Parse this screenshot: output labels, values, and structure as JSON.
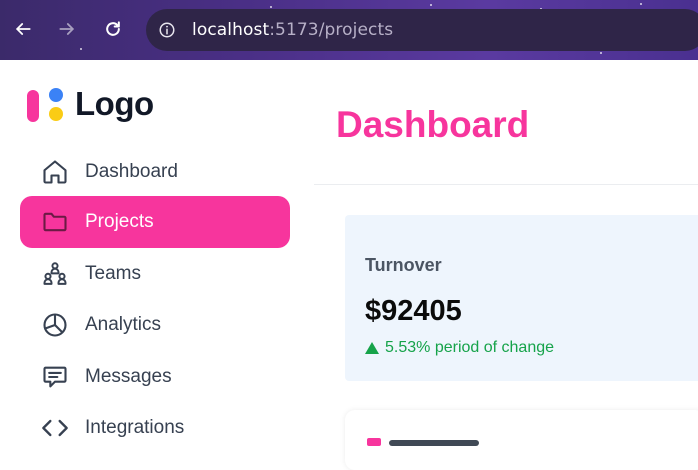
{
  "browser": {
    "url_host": "localhost",
    "url_rest": ":5173/projects"
  },
  "logo": {
    "text": "Logo"
  },
  "colors": {
    "accent": "#f7359d",
    "positive": "#16a34a",
    "card_bg": "#eef5fd"
  },
  "sidebar": {
    "items": [
      {
        "label": "Dashboard",
        "icon": "home-icon",
        "active": false
      },
      {
        "label": "Projects",
        "icon": "folder-icon",
        "active": true
      },
      {
        "label": "Teams",
        "icon": "teams-icon",
        "active": false
      },
      {
        "label": "Analytics",
        "icon": "pie-chart-icon",
        "active": false
      },
      {
        "label": "Messages",
        "icon": "message-icon",
        "active": false
      },
      {
        "label": "Integrations",
        "icon": "code-icon",
        "active": false
      }
    ]
  },
  "main": {
    "title": "Dashboard",
    "turnover": {
      "label": "Turnover",
      "value": "$92405",
      "change": "5.53% period of change"
    }
  }
}
